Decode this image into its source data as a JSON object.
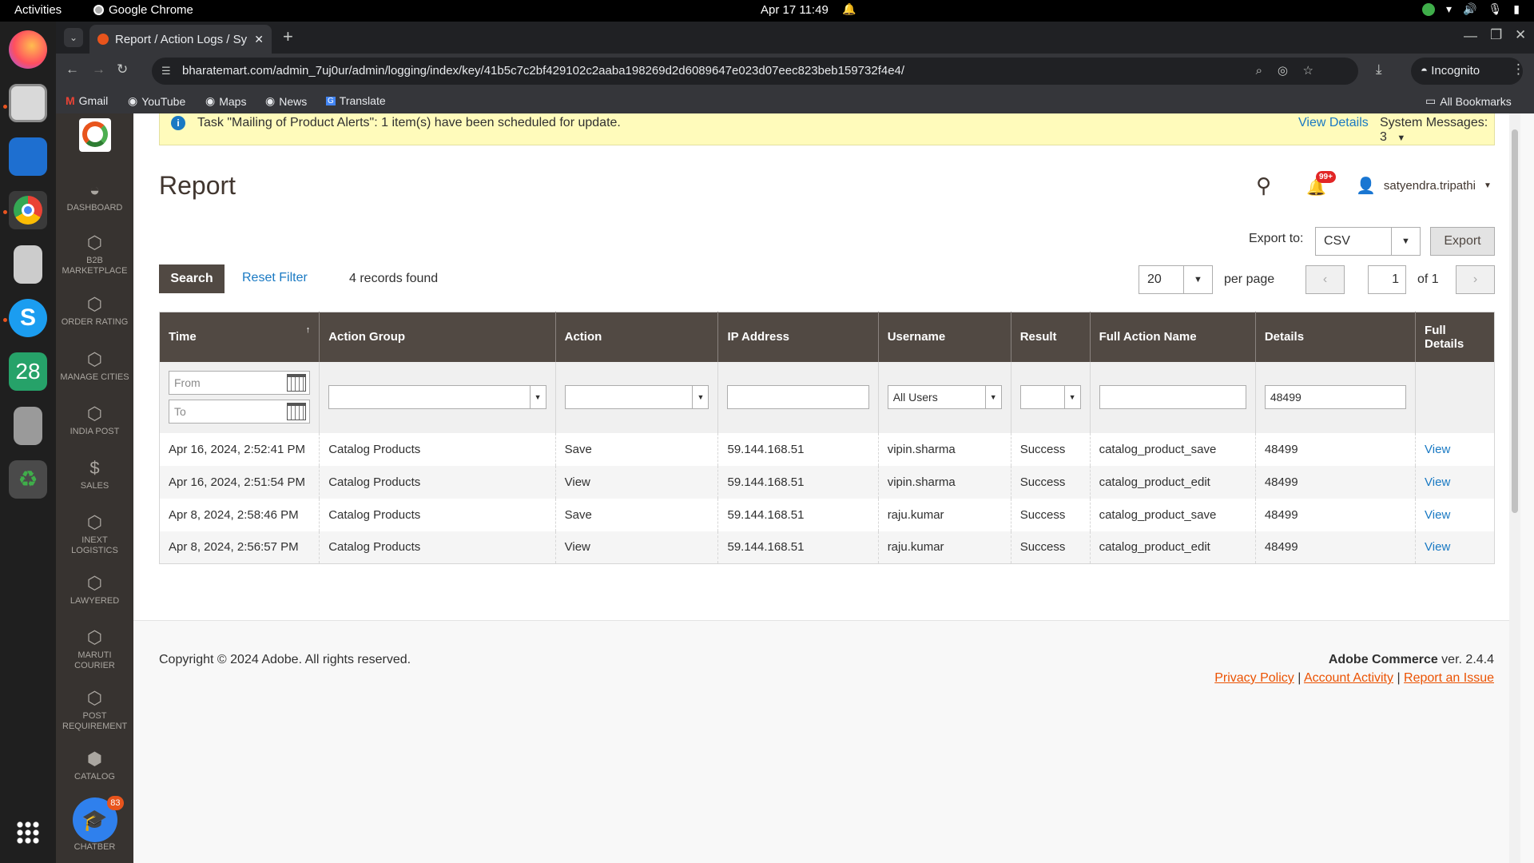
{
  "os": {
    "activities": "Activities",
    "app_name": "Google Chrome",
    "clock": "Apr 17  11:49",
    "dock_calendar_day": "28",
    "dock_badge": "83"
  },
  "browser": {
    "tab_title": "Report / Action Logs / Sy",
    "url": "bharatemart.com/admin_7uj0ur/admin/logging/index/key/41b5c7c2bf429102c2aaba198269d2d6089647e023d07eec823beb159732f4e4/",
    "profile": "Incognito",
    "bookmarks": [
      "Gmail",
      "YouTube",
      "Maps",
      "News",
      "Translate"
    ],
    "all_bookmarks": "All Bookmarks"
  },
  "admin_menu": [
    {
      "label": "DASHBOARD",
      "icon": "dashboard-icon"
    },
    {
      "label": "B2B MARKETPLACE",
      "icon": "hexagon-icon"
    },
    {
      "label": "ORDER RATING",
      "icon": "hexagon-icon"
    },
    {
      "label": "MANAGE CITIES",
      "icon": "hexagon-icon"
    },
    {
      "label": "INDIA POST",
      "icon": "hexagon-icon"
    },
    {
      "label": "SALES",
      "icon": "dollar-icon"
    },
    {
      "label": "INEXT LOGISTICS",
      "icon": "hexagon-icon"
    },
    {
      "label": "LAWYERED",
      "icon": "hexagon-icon"
    },
    {
      "label": "MARUTI COURIER",
      "icon": "hexagon-icon"
    },
    {
      "label": "POST REQUIREMENT",
      "icon": "hexagon-icon"
    },
    {
      "label": "CATALOG",
      "icon": "cube-icon"
    },
    {
      "label": "CHATBER",
      "icon": "chat-icon"
    }
  ],
  "system_message": {
    "text": "Task \"Mailing of Product Alerts\": 1 item(s) have been scheduled for update.",
    "view_details": "View Details",
    "system_messages": "System Messages: 3"
  },
  "page": {
    "title": "Report",
    "notifications_count": "99+",
    "username": "satyendra.tripathi"
  },
  "toolbar": {
    "export_label": "Export to:",
    "export_format": "CSV",
    "export_button": "Export",
    "search_button": "Search",
    "reset_filter": "Reset Filter",
    "records_found": "4 records found",
    "per_page_value": "20",
    "per_page_label": "per page",
    "current_page": "1",
    "total_pages": "of 1"
  },
  "grid": {
    "columns": [
      "Time",
      "Action Group",
      "Action",
      "IP Address",
      "Username",
      "Result",
      "Full Action Name",
      "Details",
      "Full Details"
    ],
    "filters": {
      "time_from_placeholder": "From",
      "time_to_placeholder": "To",
      "username_value": "All Users",
      "details_value": "48499"
    },
    "rows": [
      {
        "time": "Apr 16, 2024, 2:52:41 PM",
        "group": "Catalog Products",
        "action": "Save",
        "ip": "59.144.168.51",
        "user": "vipin.sharma",
        "result": "Success",
        "full_action": "catalog_product_save",
        "details": "48499",
        "link": "View"
      },
      {
        "time": "Apr 16, 2024, 2:51:54 PM",
        "group": "Catalog Products",
        "action": "View",
        "ip": "59.144.168.51",
        "user": "vipin.sharma",
        "result": "Success",
        "full_action": "catalog_product_edit",
        "details": "48499",
        "link": "View"
      },
      {
        "time": "Apr 8, 2024, 2:58:46 PM",
        "group": "Catalog Products",
        "action": "Save",
        "ip": "59.144.168.51",
        "user": "raju.kumar",
        "result": "Success",
        "full_action": "catalog_product_save",
        "details": "48499",
        "link": "View"
      },
      {
        "time": "Apr 8, 2024, 2:56:57 PM",
        "group": "Catalog Products",
        "action": "View",
        "ip": "59.144.168.51",
        "user": "raju.kumar",
        "result": "Success",
        "full_action": "catalog_product_edit",
        "details": "48499",
        "link": "View"
      }
    ]
  },
  "footer": {
    "copyright": "Copyright © 2024 Adobe. All rights reserved.",
    "product": "Adobe Commerce",
    "version": " ver. 2.4.4",
    "links": [
      "Privacy Policy",
      "Account Activity",
      "Report an Issue"
    ]
  },
  "colors": {
    "admin_menu_bg": "#373330",
    "grid_header_bg": "#514943",
    "link": "#1979c3",
    "footer_link": "#eb5202",
    "message_bg": "#fffbbb"
  }
}
